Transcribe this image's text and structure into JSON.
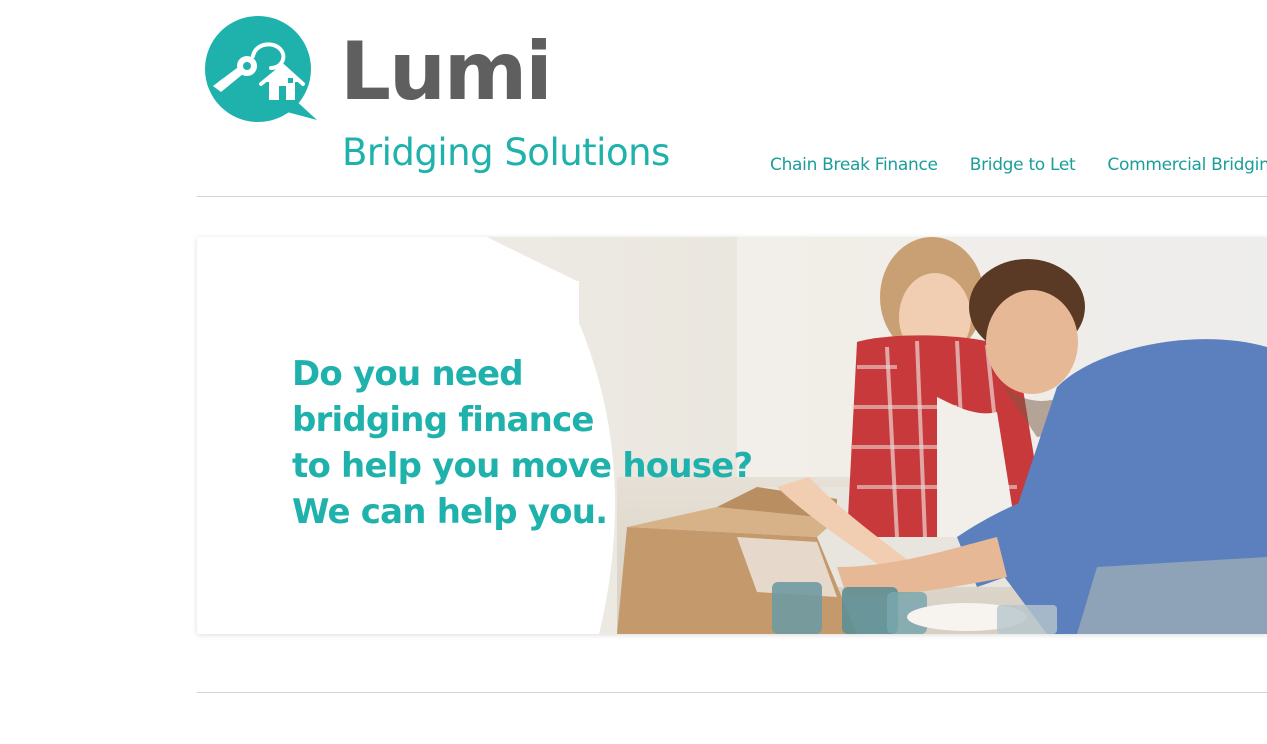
{
  "header": {
    "logo": {
      "name": "Lumi",
      "tagline": "Bridging Solutions",
      "icon": "house-keys-speech-bubble-icon"
    },
    "nav": [
      {
        "label": "Chain Break Finance"
      },
      {
        "label": "Bridge to Let"
      },
      {
        "label": "Commercial Bridging"
      }
    ]
  },
  "hero": {
    "headline_lines": [
      "Do you need",
      "bridging finance",
      "to help you move house?",
      "We can help you."
    ],
    "image": "couple-unpacking-moving-box-photo"
  },
  "colors": {
    "brand_teal": "#1fb2ad",
    "logo_grey": "#5f5f5f",
    "nav_link": "#1a9e9a",
    "divider": "#d5d5d5"
  }
}
